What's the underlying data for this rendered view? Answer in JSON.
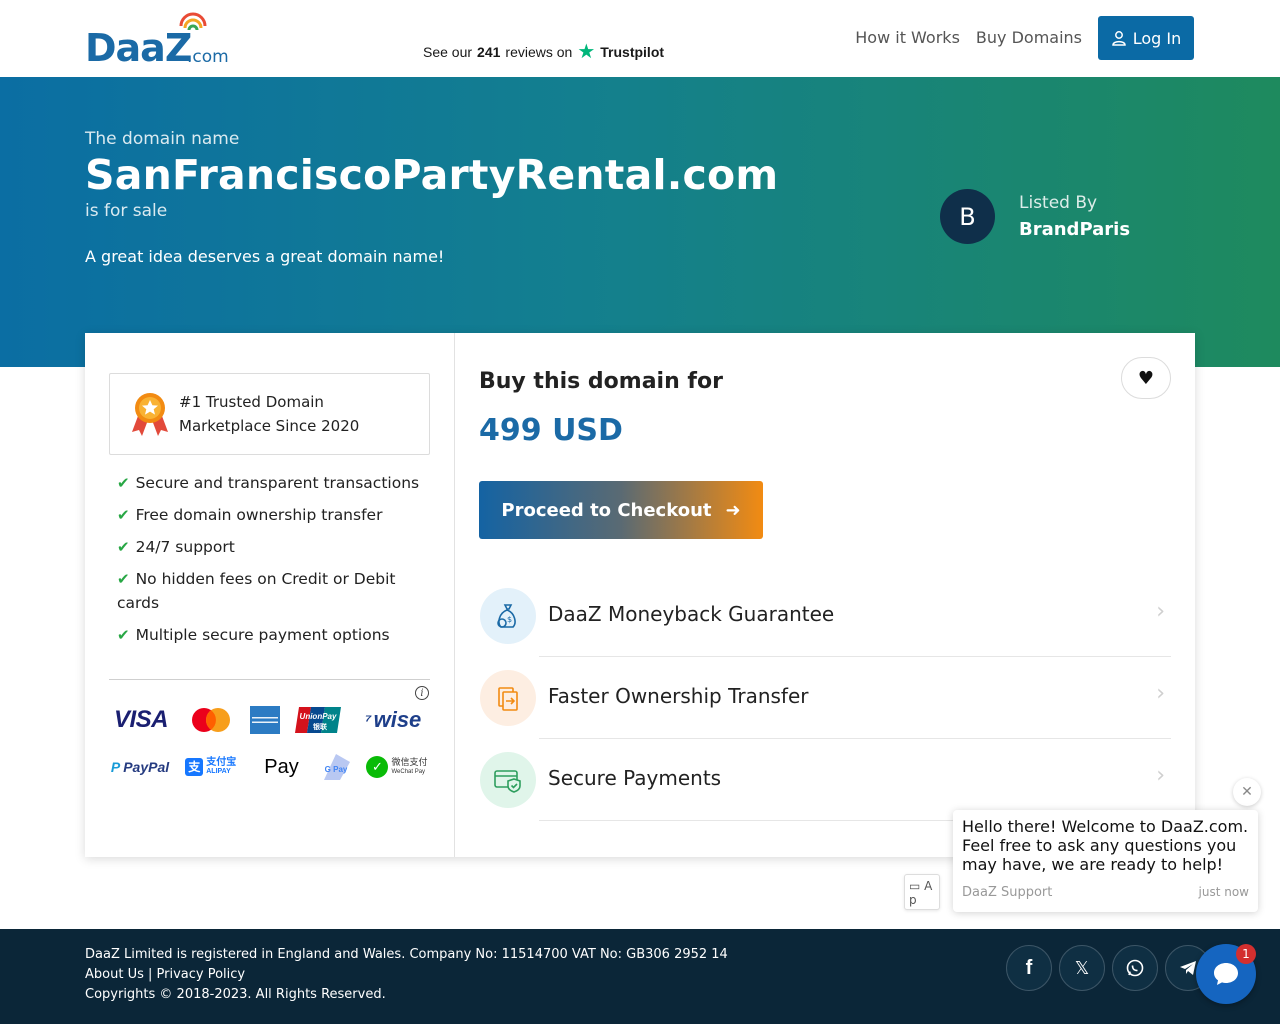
{
  "header": {
    "logo_text": "DaaZ",
    "logo_suffix": ".com",
    "trustpilot_prefix": "See our",
    "trustpilot_count": "241",
    "trustpilot_suffix": "reviews on",
    "trustpilot_brand": "Trustpilot",
    "nav": [
      "How it Works",
      "Buy Domains"
    ],
    "login_label": "Log In"
  },
  "hero": {
    "intro": "The domain name",
    "domain": "SanFranciscoPartyRental.com",
    "status": "is for sale",
    "tagline": "A great idea deserves a great domain name!",
    "seller_initial": "B",
    "listed_by_label": "Listed By",
    "seller_name": "BrandParis"
  },
  "trust": {
    "badge_text": "#1 Trusted Domain Marketplace Since 2020",
    "features": [
      "Secure and transparent transactions",
      "Free domain ownership transfer",
      "24/7 support",
      "No hidden fees on Credit or Debit cards",
      "Multiple secure payment options"
    ],
    "payment_methods_row1": [
      "VISA",
      "MasterCard",
      "American Express",
      "UnionPay",
      "wise"
    ],
    "payment_methods_row2": [
      "PayPal",
      "支付宝 ALIPAY",
      "Apple Pay",
      "G Pay",
      "微信支付 WeChat Pay"
    ]
  },
  "purchase": {
    "title": "Buy this domain for",
    "price": "499 USD",
    "checkout_label": "Proceed to Checkout",
    "benefits": [
      {
        "label": "DaaZ Moneyback Guarantee",
        "icon": "money-bag-icon",
        "bg": "#e3f1fa"
      },
      {
        "label": "Faster Ownership Transfer",
        "icon": "document-transfer-icon",
        "bg": "#fdeee2"
      },
      {
        "label": "Secure Payments",
        "icon": "secure-card-icon",
        "bg": "#e0f5ea"
      }
    ]
  },
  "chat": {
    "message": "Hello there! Welcome to DaaZ.com. Feel free to ask any questions you may have, we are ready to help!",
    "from": "DaaZ Support",
    "time": "just now",
    "img_alt": "A p",
    "badge_count": "1"
  },
  "footer": {
    "registration": "DaaZ Limited is registered in England and Wales. Company No: 11514700   VAT No: GB306 2952 14",
    "about": "About Us",
    "separator": "|",
    "privacy": "Privacy Policy",
    "copyright": "Copyrights © 2018-2023. All Rights Reserved.",
    "social": [
      "facebook-icon",
      "x-icon",
      "whatsapp-icon",
      "telegram-icon"
    ]
  },
  "colors": {
    "brand_blue": "#1b6aa6",
    "login_bg": "#0b6aa5",
    "footer_bg": "#0b2638",
    "check_green": "#28a745",
    "checkout_orange": "#f28b12"
  }
}
